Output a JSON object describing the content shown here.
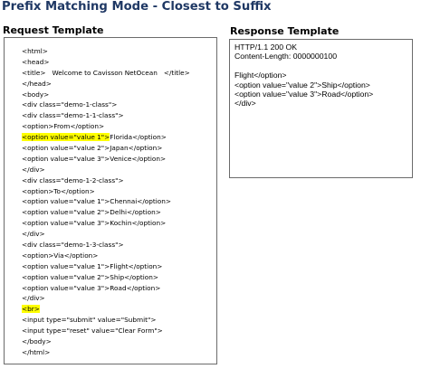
{
  "title": "Prefix Matching Mode - Closest to Suffix",
  "request": {
    "heading": "Request Template",
    "lines": [
      {
        "pre": "<html>",
        "hl": "",
        "post": ""
      },
      {
        "pre": "<head>",
        "hl": "",
        "post": ""
      },
      {
        "pre": "<title>   Welcome to Cavisson NetOcean   </title>",
        "hl": "",
        "post": ""
      },
      {
        "pre": "</head>",
        "hl": "",
        "post": ""
      },
      {
        "pre": "<body>",
        "hl": "",
        "post": ""
      },
      {
        "pre": "<div class=\"demo-1-class\">",
        "hl": "",
        "post": ""
      },
      {
        "pre": "<div class=\"demo-1-1-class\">",
        "hl": "",
        "post": ""
      },
      {
        "pre": "<option>From</option>",
        "hl": "",
        "post": ""
      },
      {
        "pre": "",
        "hl": "<option value=\"value 1\">",
        "post": "Florida</option>"
      },
      {
        "pre": "<option value=\"value 2\">Japan</option>",
        "hl": "",
        "post": ""
      },
      {
        "pre": "<option value=\"value 3\">Venice</option>",
        "hl": "",
        "post": ""
      },
      {
        "pre": "</div>",
        "hl": "",
        "post": ""
      },
      {
        "pre": "<div class=\"demo-1-2-class\">",
        "hl": "",
        "post": ""
      },
      {
        "pre": "<option>To</option>",
        "hl": "",
        "post": ""
      },
      {
        "pre": "<option value=\"value 1\">Chennai</option>",
        "hl": "",
        "post": ""
      },
      {
        "pre": "<option value=\"value 2\">Delhi</option>",
        "hl": "",
        "post": ""
      },
      {
        "pre": "<option value=\"value 3\">Kochin</option>",
        "hl": "",
        "post": ""
      },
      {
        "pre": "</div>",
        "hl": "",
        "post": ""
      },
      {
        "pre": "<div class=\"demo-1-3-class\">",
        "hl": "",
        "post": ""
      },
      {
        "pre": "<option>Via</option>",
        "hl": "",
        "post": ""
      },
      {
        "pre": "<option value=\"value 1\">Flight</option>",
        "hl": "",
        "post": ""
      },
      {
        "pre": "<option value=\"value 2\">Ship</option>",
        "hl": "",
        "post": ""
      },
      {
        "pre": "<option value=\"value 3\">Road</option>",
        "hl": "",
        "post": ""
      },
      {
        "pre": "</div>",
        "hl": "",
        "post": ""
      },
      {
        "pre": "",
        "hl": "<br>",
        "post": ""
      },
      {
        "pre": "<input type=\"submit\" value=\"Submit\">",
        "hl": "",
        "post": ""
      },
      {
        "pre": "<input type=\"reset\" value=\"Clear Form\">",
        "hl": "",
        "post": ""
      },
      {
        "pre": "</body>",
        "hl": "",
        "post": ""
      },
      {
        "pre": "</html>",
        "hl": "",
        "post": ""
      }
    ]
  },
  "response": {
    "heading": "Response Template",
    "lines": [
      "HTTP/1.1 200 OK",
      "Content-Length: 0000000100",
      "",
      "Flight</option>",
      "<option value=\"value 2\">Ship</option>",
      "<option value=\"value 3\">Road</option>",
      "</div>"
    ]
  },
  "colors": {
    "title": "#1f3864",
    "highlight": "#ffff00",
    "border": "#6b6b6b"
  }
}
